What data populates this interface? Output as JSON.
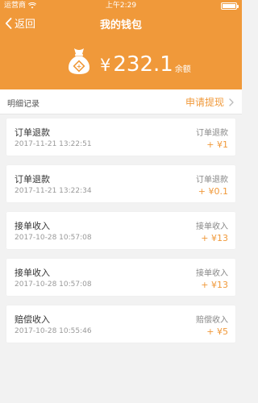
{
  "status_bar": {
    "carrier": "运营商",
    "time": "上午2:29"
  },
  "nav": {
    "back_label": "返回",
    "title": "我的钱包"
  },
  "balance": {
    "currency": "¥",
    "amount": "232.1",
    "label": "余额"
  },
  "records": {
    "label": "明细记录",
    "withdraw_label": "申请提现"
  },
  "items": [
    {
      "title": "订单退款",
      "date": "2017-11-21 13:22:51",
      "type": "订单退款",
      "change": "+ ¥1"
    },
    {
      "title": "订单退款",
      "date": "2017-11-21 13:22:34",
      "type": "订单退款",
      "change": "+ ¥0.1"
    },
    {
      "title": "接单收入",
      "date": "2017-10-28 10:57:08",
      "type": "接单收入",
      "change": "+ ¥13"
    },
    {
      "title": "接单收入",
      "date": "2017-10-28 10:57:08",
      "type": "接单收入",
      "change": "+ ¥13"
    },
    {
      "title": "赔偿收入",
      "date": "2017-10-28 10:55:46",
      "type": "赔偿收入",
      "change": "+ ¥5"
    }
  ],
  "colors": {
    "accent": "#f0993a",
    "background": "#f2f2f2"
  },
  "icons": [
    "wifi-icon",
    "battery-icon",
    "back-arrow-icon",
    "money-bag-icon",
    "chevron-right-icon"
  ]
}
